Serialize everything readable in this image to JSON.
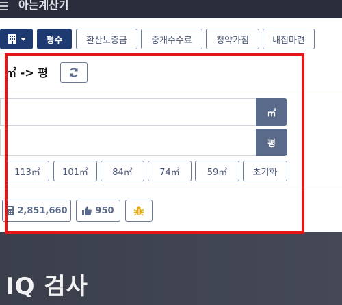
{
  "header": {
    "title": "아는계산기"
  },
  "toolbar": {
    "active_label": "평수",
    "tabs": [
      "환산보증금",
      "중개수수료",
      "청약가점",
      "내집마련"
    ]
  },
  "card": {
    "title": "㎡ -> 평",
    "inputs": [
      {
        "unit": "㎡",
        "value": ""
      },
      {
        "unit": "평",
        "value": ""
      }
    ],
    "presets": [
      "113㎡",
      "101㎡",
      "84㎡",
      "74㎡",
      "59㎡"
    ],
    "reset_label": "초기화"
  },
  "stats": {
    "count": "2,851,660",
    "likes": "950"
  },
  "banner": {
    "text": "IQ 검사"
  },
  "colors": {
    "primary": "#1f3a70",
    "unit": "#5a6a8a",
    "outline": "#6b7a95",
    "highlight": "#e51616",
    "bug": "#e7a817"
  }
}
